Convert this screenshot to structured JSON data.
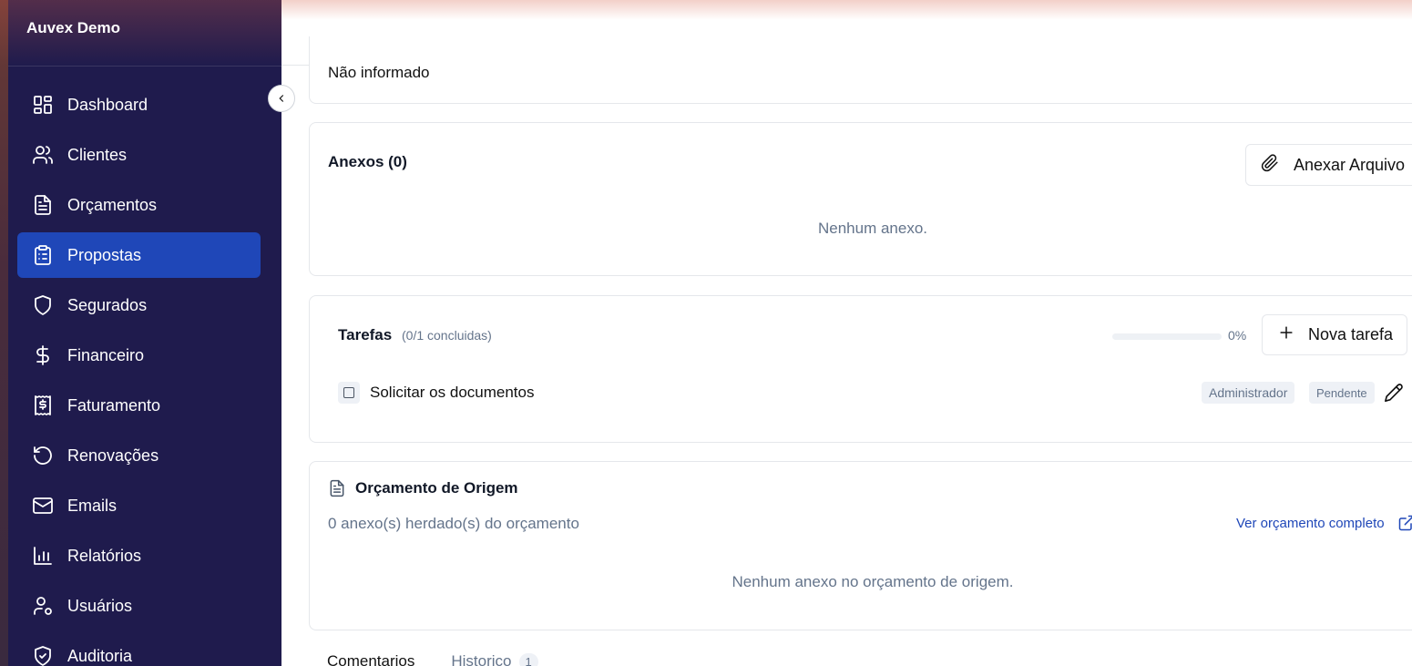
{
  "brand": "Auvex Demo",
  "sidebar": {
    "items": [
      {
        "label": "Dashboard",
        "icon": "dashboard-icon"
      },
      {
        "label": "Clientes",
        "icon": "users-icon"
      },
      {
        "label": "Orçamentos",
        "icon": "document-icon"
      },
      {
        "label": "Propostas",
        "icon": "clipboard-list-icon",
        "active": true
      },
      {
        "label": "Segurados",
        "icon": "shield-icon"
      },
      {
        "label": "Financeiro",
        "icon": "dollar-icon"
      },
      {
        "label": "Faturamento",
        "icon": "receipt-icon"
      },
      {
        "label": "Renovações",
        "icon": "rotate-icon"
      },
      {
        "label": "Emails",
        "icon": "mail-icon"
      },
      {
        "label": "Relatórios",
        "icon": "bar-chart-icon"
      },
      {
        "label": "Usuários",
        "icon": "user-cog-icon"
      },
      {
        "label": "Auditoria",
        "icon": "shield-check-icon"
      }
    ]
  },
  "info_card": {
    "value": "Não informado"
  },
  "attachments": {
    "title": "Anexos (0)",
    "button_label": "Anexar Arquivo",
    "empty_text": "Nenhum anexo."
  },
  "tasks": {
    "title": "Tarefas",
    "subtitle": "(0/1 concluidas)",
    "progress_percent": 0,
    "progress_label": "0%",
    "button_label": "Nova tarefa",
    "items": [
      {
        "name": "Solicitar os documentos",
        "assignee": "Administrador",
        "status": "Pendente",
        "done": false
      }
    ]
  },
  "origin": {
    "title": "Orçamento de Origem",
    "subtitle": "0 anexo(s) herdado(s) do orçamento",
    "link_label": "Ver orçamento completo",
    "empty_text": "Nenhum anexo no orçamento de origem."
  },
  "bottom_tabs": {
    "comments": "Comentarios",
    "history": "Historico",
    "history_count": "1"
  },
  "colors": {
    "sidebar_bg": "#1f1b4d",
    "accent": "#1f47b8",
    "muted_text": "#64748b"
  }
}
